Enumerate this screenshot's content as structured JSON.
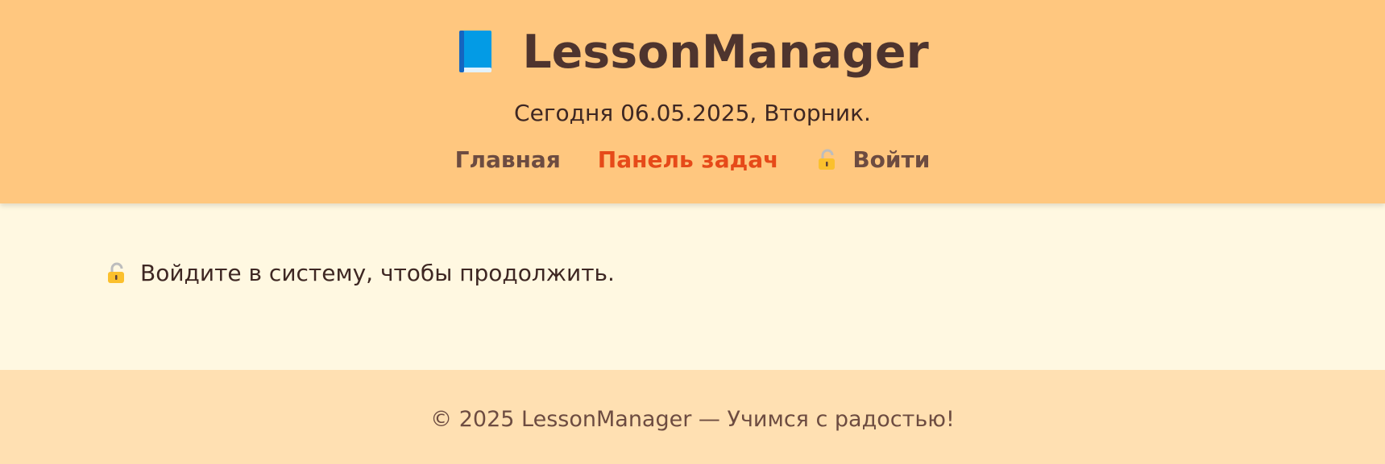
{
  "header": {
    "app_title": "LessonManager",
    "book_icon": "blue-book-icon",
    "date_line": "Сегодня 06.05.2025, Вторник.",
    "nav": {
      "home": "Главная",
      "dashboard": "Панель задач",
      "login": "Войти",
      "login_icon": "lock-icon"
    }
  },
  "main": {
    "notice_icon": "lock-icon",
    "notice_text": "Войдите в систему, чтобы продолжить."
  },
  "footer": {
    "text": "© 2025 LessonManager — Учимся с радостью!"
  },
  "colors": {
    "header_bg": "#ffc77f",
    "main_bg": "#fff8e1",
    "footer_bg": "#ffe0b2",
    "title": "#4e342e",
    "nav_link": "#6d4c41",
    "nav_active": "#e64a19"
  }
}
